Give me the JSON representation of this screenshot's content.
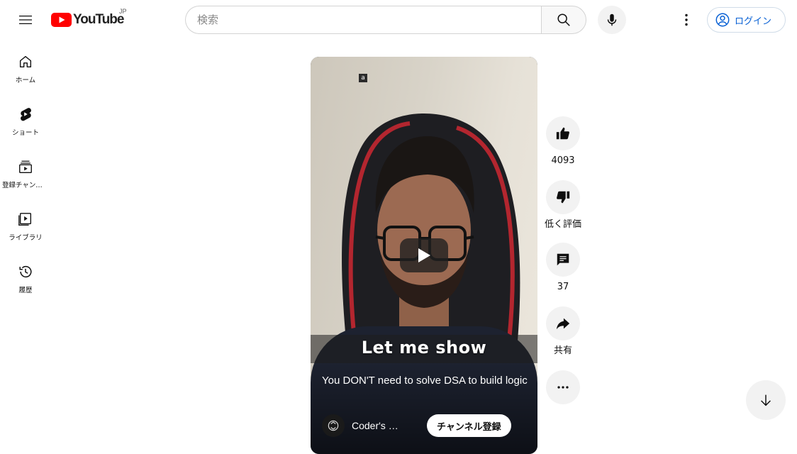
{
  "header": {
    "logo_text": "YouTube",
    "logo_country": "JP",
    "search_placeholder": "検索",
    "signin_label": "ログイン"
  },
  "sidebar": {
    "items": [
      {
        "label": "ホーム",
        "icon": "home-icon"
      },
      {
        "label": "ショート",
        "icon": "shorts-icon"
      },
      {
        "label": "登録チャンネル",
        "icon": "subscriptions-icon"
      },
      {
        "label": "ライブラリ",
        "icon": "library-icon"
      },
      {
        "label": "履歴",
        "icon": "history-icon"
      }
    ]
  },
  "video": {
    "overlay_badge": "a",
    "caption": "Let me show",
    "title": "You DON'T need to solve DSA to build logic",
    "channel_name": "Coder's …",
    "subscribe_label": "チャンネル登録"
  },
  "actions": {
    "like_count": "4093",
    "dislike_label": "低く評価",
    "comment_count": "37",
    "share_label": "共有"
  },
  "colors": {
    "brand_red": "#ff0000",
    "link_blue": "#065fd4",
    "button_gray": "#f2f2f2"
  }
}
